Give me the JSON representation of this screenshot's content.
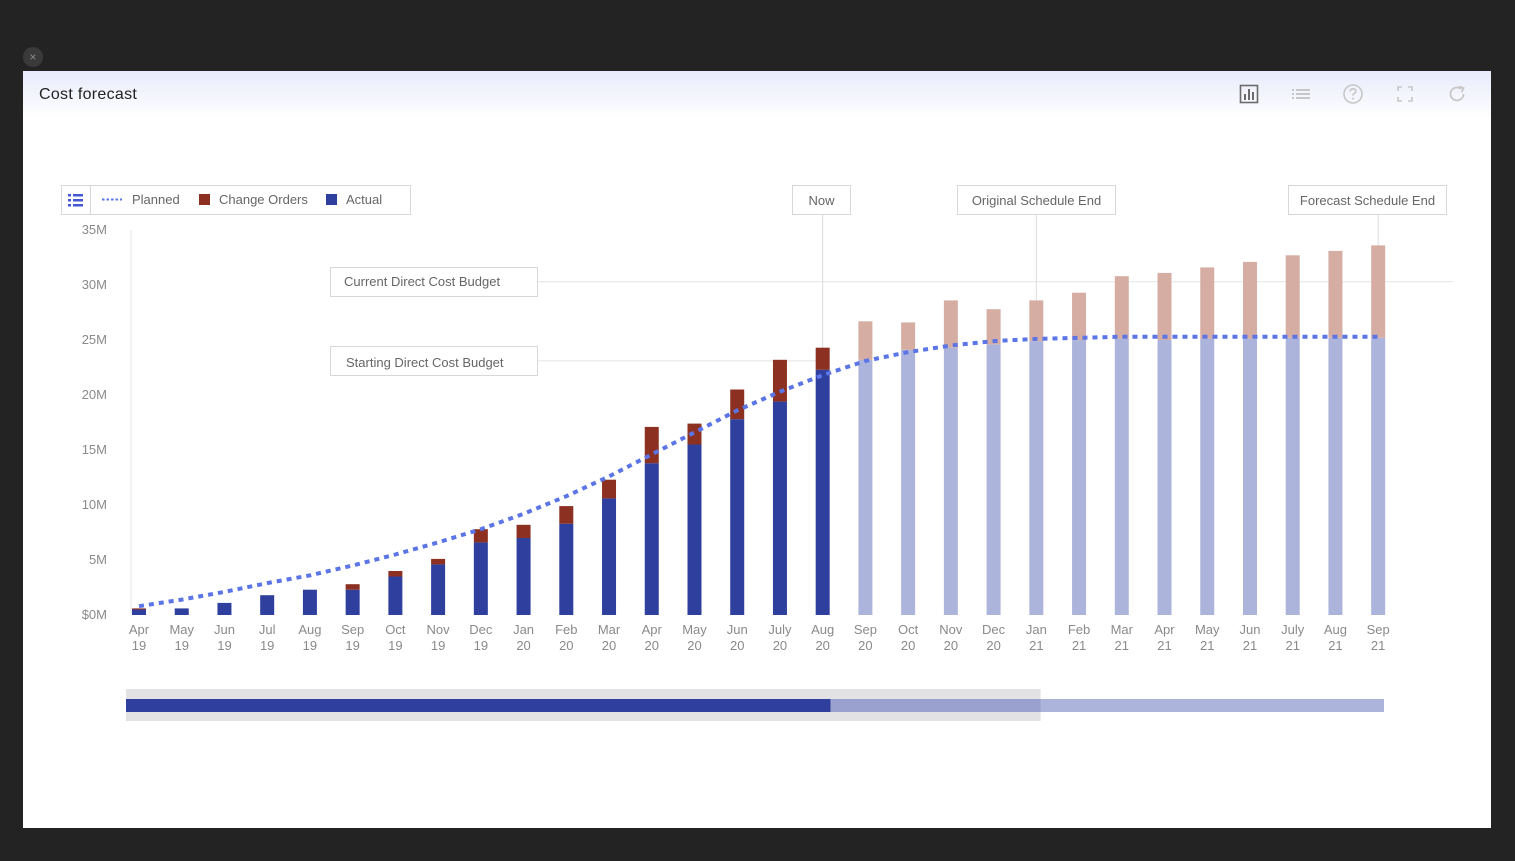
{
  "window": {
    "close_glyph": "×"
  },
  "panel": {
    "title": "Cost forecast",
    "toolbar": [
      {
        "name": "bar-chart-icon"
      },
      {
        "name": "list-icon"
      },
      {
        "name": "help-icon"
      },
      {
        "name": "fullscreen-icon"
      },
      {
        "name": "refresh-icon"
      }
    ]
  },
  "colors": {
    "actual": "#2f3f9e",
    "actual_forecast": "#adb4dc",
    "change_orders": "#8c3021",
    "change_orders_forecast": "#d6ada3",
    "planned": "#5b74e6",
    "navigator_fill": "#2f3f9e",
    "navigator_forecast": "#adb4dc"
  },
  "chart_data": {
    "type": "bar",
    "stacked": true,
    "yticks": [
      "$0M",
      "5M",
      "10M",
      "15M",
      "20M",
      "25M",
      "30M",
      "35M"
    ],
    "ylim": [
      0,
      35
    ],
    "categories": [
      "Apr 19",
      "May 19",
      "Jun 19",
      "Jul 19",
      "Aug 19",
      "Sep 19",
      "Oct 19",
      "Nov 19",
      "Dec 19",
      "Jan 20",
      "Feb 20",
      "Mar 20",
      "Apr 20",
      "May 20",
      "Jun 20",
      "July 20",
      "Aug 20",
      "Sep 20",
      "Oct 20",
      "Nov 20",
      "Dec 20",
      "Jan 21",
      "Feb 21",
      "Mar 21",
      "Apr 21",
      "May 21",
      "Jun 21",
      "July 21",
      "Aug 21",
      "Sep 21"
    ],
    "forecast_from_index": 17,
    "legend": [
      "Planned",
      "Change Orders",
      "Actual"
    ],
    "series": [
      {
        "name": "Actual",
        "values": [
          0.5,
          0.6,
          1.1,
          1.8,
          2.3,
          2.3,
          3.5,
          4.6,
          6.6,
          7.0,
          8.3,
          10.6,
          13.8,
          15.5,
          17.8,
          19.4,
          22.3,
          23.2,
          24.1,
          24.3,
          24.6,
          24.9,
          25.0,
          25.1,
          25.0,
          25.1,
          25.1,
          25.2,
          25.2,
          25.2
        ]
      },
      {
        "name": "Change Orders",
        "values": [
          0.1,
          0.0,
          0.0,
          0.0,
          0.0,
          0.5,
          0.5,
          0.5,
          1.2,
          1.2,
          1.6,
          1.7,
          3.3,
          1.9,
          2.7,
          3.8,
          2.0,
          3.5,
          2.5,
          4.3,
          3.2,
          3.7,
          4.3,
          5.7,
          6.1,
          6.5,
          7.0,
          7.5,
          7.9,
          8.4
        ]
      },
      {
        "name": "Planned",
        "values": [
          0.8,
          1.4,
          2.1,
          2.9,
          3.6,
          4.5,
          5.5,
          6.6,
          7.8,
          9.2,
          10.8,
          12.6,
          14.6,
          16.6,
          18.6,
          20.3,
          21.8,
          23.1,
          23.9,
          24.5,
          24.9,
          25.1,
          25.2,
          25.3,
          25.3,
          25.3,
          25.3,
          25.3,
          25.3,
          25.3
        ]
      }
    ],
    "annotations": {
      "now": {
        "label": "Now",
        "at_index": 16
      },
      "original_end": {
        "label": "Original Schedule End",
        "at_index": 21
      },
      "forecast_end": {
        "label": "Forecast Schedule End",
        "at_index": 29
      },
      "current_budget": {
        "label": "Current Direct Cost Budget",
        "value": 30.3
      },
      "starting_budget": {
        "label": "Starting Direct Cost Budget",
        "value": 23.1
      }
    },
    "navigator": {
      "actual_until_fraction": 0.56,
      "selection_end_fraction": 0.727
    }
  }
}
